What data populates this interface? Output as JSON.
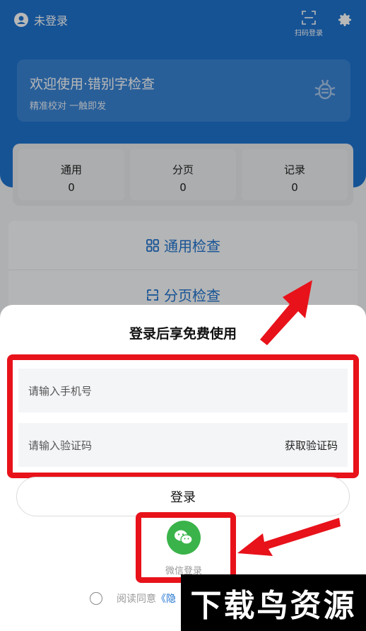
{
  "header": {
    "user_label": "未登录",
    "scan_label": "扫码登录"
  },
  "welcome": {
    "title": "欢迎使用·错别字检查",
    "subtitle": "精准校对 一触即发"
  },
  "stats": [
    {
      "label": "通用",
      "value": "0"
    },
    {
      "label": "分页",
      "value": "0"
    },
    {
      "label": "记录",
      "value": "0"
    }
  ],
  "menu": {
    "general_check": "通用检查",
    "page_check": "分页检查"
  },
  "login_sheet": {
    "title": "登录后享免费使用",
    "phone_placeholder": "请输入手机号",
    "code_placeholder": "请输入验证码",
    "get_code": "获取验证码",
    "login_button": "登录",
    "wechat_login": "微信登录",
    "agree_text": "阅读同意",
    "agree_link": "《隐"
  },
  "watermark": "下载鸟资源",
  "colors": {
    "primary": "#1f73cf",
    "highlight": "#e8121a",
    "wechat": "#3ab34a"
  }
}
